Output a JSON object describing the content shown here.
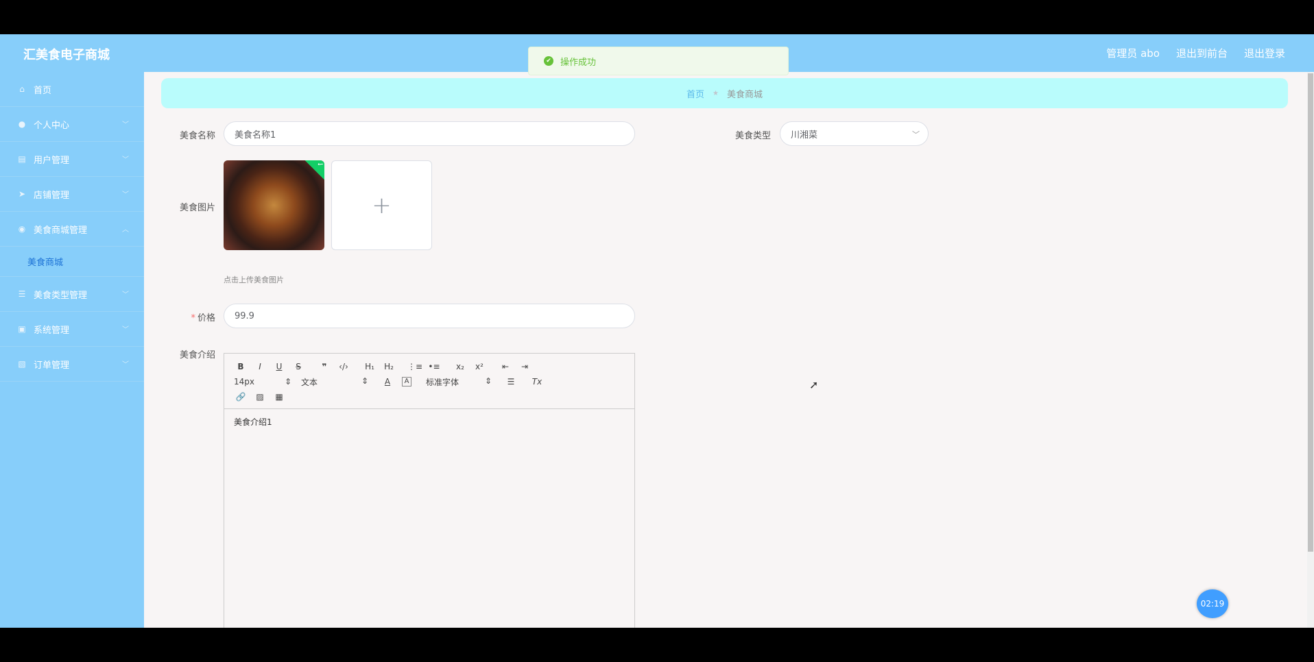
{
  "header": {
    "brand": "汇美食电子商城",
    "admin": "管理员 abo",
    "front": "退出到前台",
    "logout": "退出登录"
  },
  "toast": {
    "message": "操作成功"
  },
  "sidebar": {
    "items": [
      {
        "label": "首页",
        "icon": "home-icon"
      },
      {
        "label": "个人中心",
        "icon": "user-icon"
      },
      {
        "label": "用户管理",
        "icon": "chart-icon"
      },
      {
        "label": "店铺管理",
        "icon": "location-icon"
      },
      {
        "label": "美食商城管理",
        "icon": "shop-icon"
      },
      {
        "label": "美食类型管理",
        "icon": "list-icon"
      },
      {
        "label": "系统管理",
        "icon": "settings-icon"
      },
      {
        "label": "订单管理",
        "icon": "order-icon"
      }
    ],
    "sub_item": "美食商城"
  },
  "breadcrumb": {
    "home": "首页",
    "current": "美食商城"
  },
  "form": {
    "name_label": "美食名称",
    "name_value": "美食名称1",
    "type_label": "美食类型",
    "type_value": "川湘菜",
    "image_label": "美食图片",
    "image_hint": "点击上传美食图片",
    "price_label": "价格",
    "price_value": "99.9",
    "intro_label": "美食介绍",
    "intro_value": "美食介绍1"
  },
  "editor": {
    "size": "14px",
    "header": "文本",
    "font": "标准字体"
  },
  "timer": "02:19"
}
